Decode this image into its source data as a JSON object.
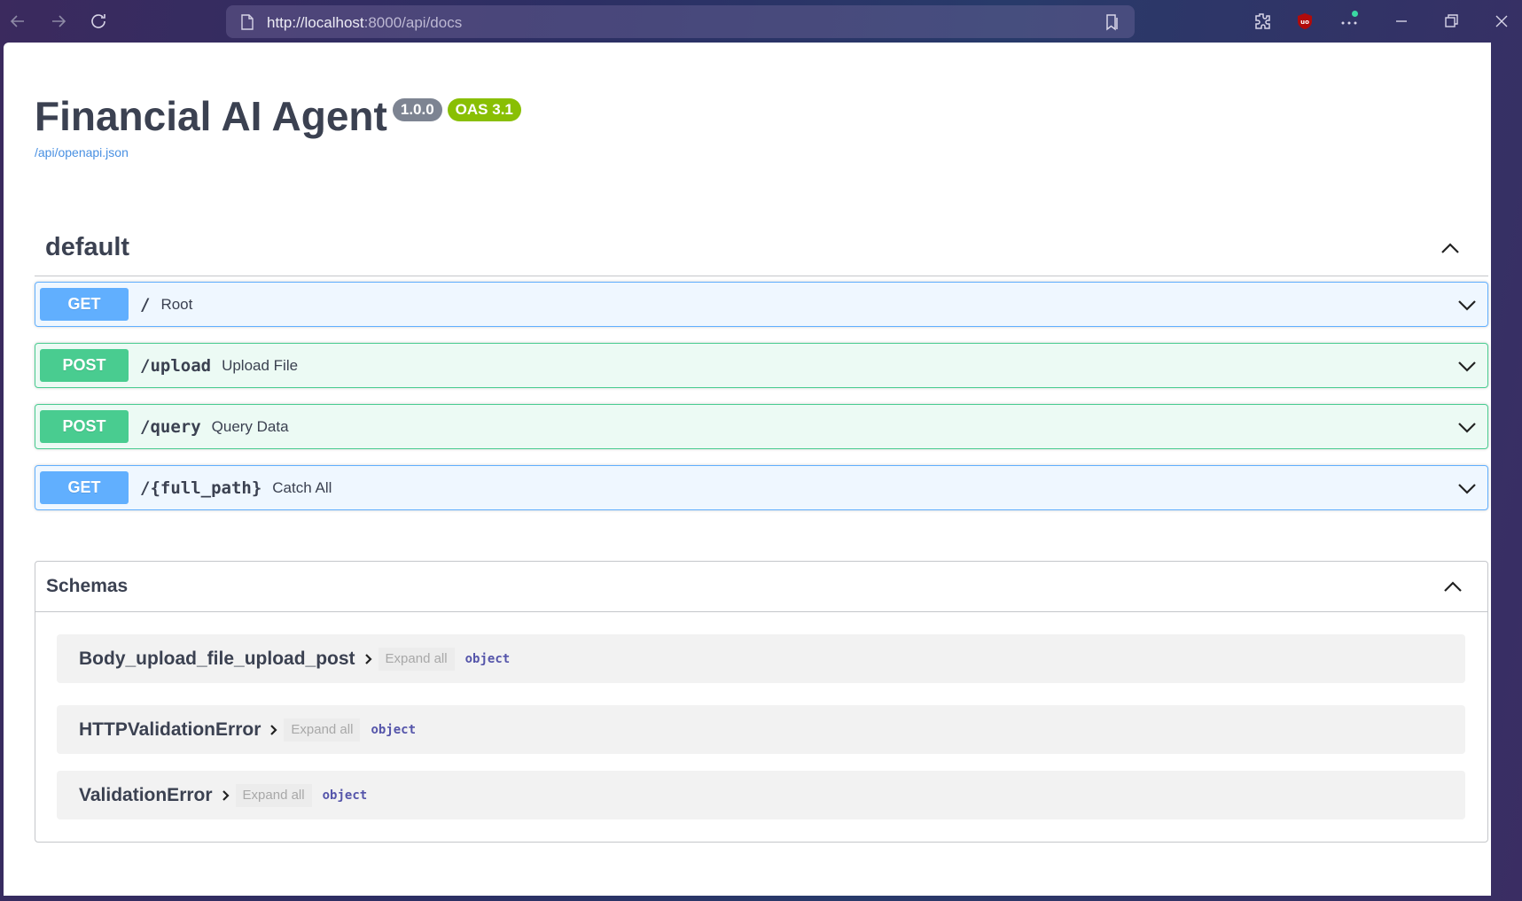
{
  "browser": {
    "url_host": "http://localhost",
    "url_rest": ":8000/api/docs"
  },
  "info": {
    "title": "Financial AI Agent",
    "version": "1.0.0",
    "oas": "OAS 3.1",
    "spec_url": "/api/openapi.json"
  },
  "tag": {
    "name": "default",
    "operations": [
      {
        "method": "GET",
        "path": "/",
        "summary": "Root"
      },
      {
        "method": "POST",
        "path": "/upload",
        "summary": "Upload File"
      },
      {
        "method": "POST",
        "path": "/query",
        "summary": "Query Data"
      },
      {
        "method": "GET",
        "path": "/{full_path}",
        "summary": "Catch All"
      }
    ]
  },
  "schemas": {
    "title": "Schemas",
    "expand_label": "Expand all",
    "models": [
      {
        "name": "Body_upload_file_upload_post",
        "type": "object"
      },
      {
        "name": "HTTPValidationError",
        "type": "object"
      },
      {
        "name": "ValidationError",
        "type": "object"
      }
    ]
  },
  "colors": {
    "get": "#61affe",
    "post": "#49cc90",
    "version_badge": "#7d8492",
    "oas_badge": "#89bf04",
    "link": "#4990e2"
  }
}
